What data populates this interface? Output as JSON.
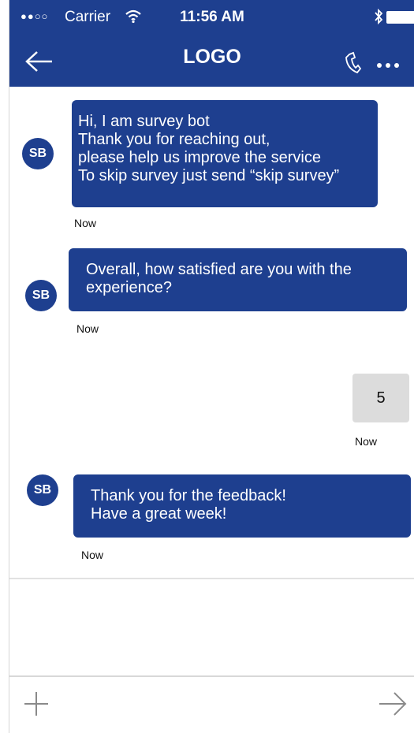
{
  "status_bar": {
    "signal": "●●○○",
    "carrier": "Carrier",
    "time": "11:56 AM"
  },
  "nav": {
    "title": "LOGO"
  },
  "messages": [
    {
      "sender": "SB",
      "lines": [
        "Hi, I am survey bot",
        "Thank you for reaching out,",
        "please help us improve the service",
        "To skip survey just send “skip survey”"
      ],
      "time": "Now"
    },
    {
      "sender": "SB",
      "lines": [
        "Overall, how satisfied are you with the",
        "experience?"
      ],
      "time": "Now"
    },
    {
      "sender": "user",
      "text": "5",
      "time": "Now"
    },
    {
      "sender": "SB",
      "lines": [
        "Thank you for the feedback!",
        "Have a great week!"
      ],
      "time": "Now"
    }
  ],
  "icons": {
    "back": "arrow-left-icon",
    "call": "phone-icon",
    "more": "more-icon",
    "add": "plus-icon",
    "send": "arrow-right-icon",
    "wifi": "wifi-icon",
    "bluetooth": "bluetooth-icon",
    "battery": "battery-icon"
  },
  "colors": {
    "brand": "#1e3f8f",
    "reply_bubble": "#dcdcdc"
  }
}
